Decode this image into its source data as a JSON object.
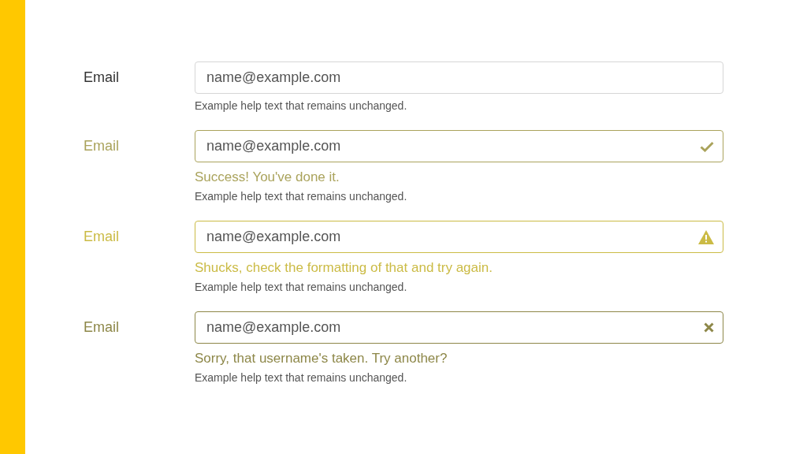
{
  "fields": [
    {
      "kind": "default",
      "label": "Email",
      "value": "name@example.com",
      "help": "Example help text that remains unchanged."
    },
    {
      "kind": "success",
      "label": "Email",
      "value": "name@example.com",
      "feedback": "Success! You've done it.",
      "help": "Example help text that remains unchanged."
    },
    {
      "kind": "warning",
      "label": "Email",
      "value": "name@example.com",
      "feedback": "Shucks, check the formatting of that and try again.",
      "help": "Example help text that remains unchanged."
    },
    {
      "kind": "danger",
      "label": "Email",
      "value": "name@example.com",
      "feedback": "Sorry, that username's taken. Try another?",
      "help": "Example help text that remains unchanged."
    }
  ]
}
